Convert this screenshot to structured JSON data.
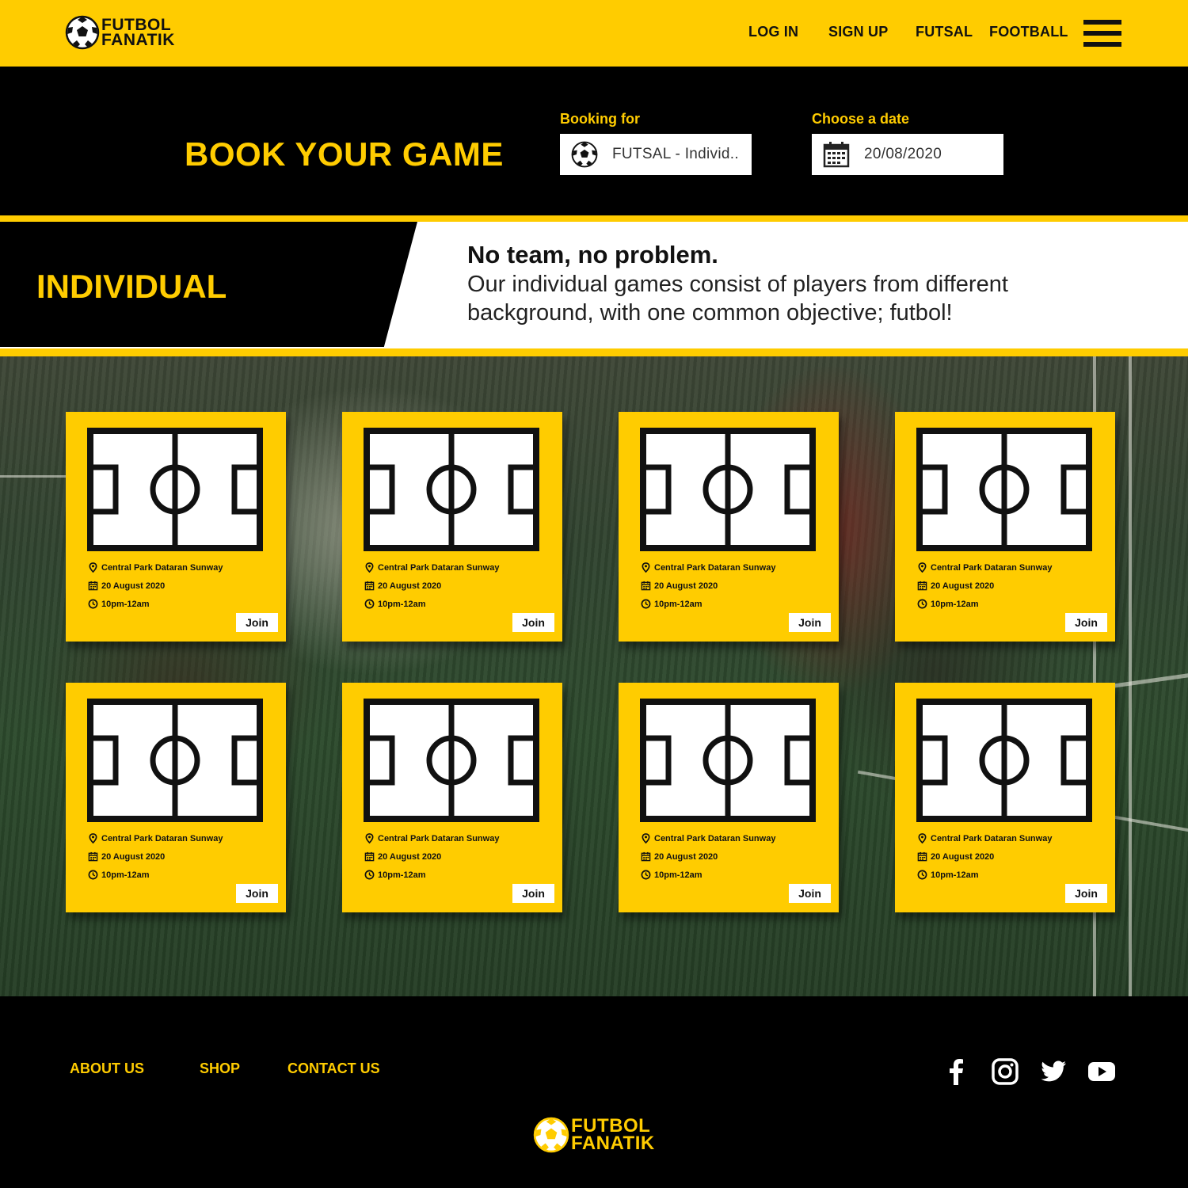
{
  "header": {
    "logo": {
      "line1": "FUTBOL",
      "line2": "FANATIK"
    },
    "nav": [
      {
        "label": "LOG IN"
      },
      {
        "label": "SIGN UP"
      },
      {
        "label": "FUTSAL"
      },
      {
        "label": "FOOTBALL"
      }
    ],
    "menu_icon": "hamburger-menu-icon"
  },
  "booking": {
    "title": "BOOK YOUR GAME",
    "booking_for": {
      "label": "Booking for",
      "value": "FUTSAL - Individ..",
      "icon": "soccer-ball-icon"
    },
    "date": {
      "label": "Choose a date",
      "value": "20/08/2020",
      "icon": "calendar-icon"
    }
  },
  "section": {
    "title": "INDIVIDUAL",
    "tagline": "No team, no problem.",
    "description": "Our individual games consist of players from different background, with one common objective; futbol!"
  },
  "games": [
    {
      "location": "Central Park Dataran Sunway",
      "date": "20 August 2020",
      "time": "10pm-12am",
      "join_label": "Join"
    },
    {
      "location": "Central Park Dataran Sunway",
      "date": "20 August 2020",
      "time": "10pm-12am",
      "join_label": "Join"
    },
    {
      "location": "Central Park Dataran Sunway",
      "date": "20 August 2020",
      "time": "10pm-12am",
      "join_label": "Join"
    },
    {
      "location": "Central Park Dataran Sunway",
      "date": "20 August 2020",
      "time": "10pm-12am",
      "join_label": "Join"
    },
    {
      "location": "Central Park Dataran Sunway",
      "date": "20 August 2020",
      "time": "10pm-12am",
      "join_label": "Join"
    },
    {
      "location": "Central Park Dataran Sunway",
      "date": "20 August 2020",
      "time": "10pm-12am",
      "join_label": "Join"
    },
    {
      "location": "Central Park Dataran Sunway",
      "date": "20 August 2020",
      "time": "10pm-12am",
      "join_label": "Join"
    },
    {
      "location": "Central Park Dataran Sunway",
      "date": "20 August 2020",
      "time": "10pm-12am",
      "join_label": "Join"
    }
  ],
  "footer": {
    "links": [
      {
        "label": "ABOUT US"
      },
      {
        "label": "SHOP"
      },
      {
        "label": "CONTACT US"
      }
    ],
    "social_icons": [
      "facebook-icon",
      "instagram-icon",
      "twitter-icon",
      "youtube-icon"
    ],
    "logo": {
      "line1": "FUTBOL",
      "line2": "FANATIK"
    }
  },
  "colors": {
    "brand_yellow": "#ffcc00",
    "black": "#000000",
    "white": "#ffffff"
  }
}
